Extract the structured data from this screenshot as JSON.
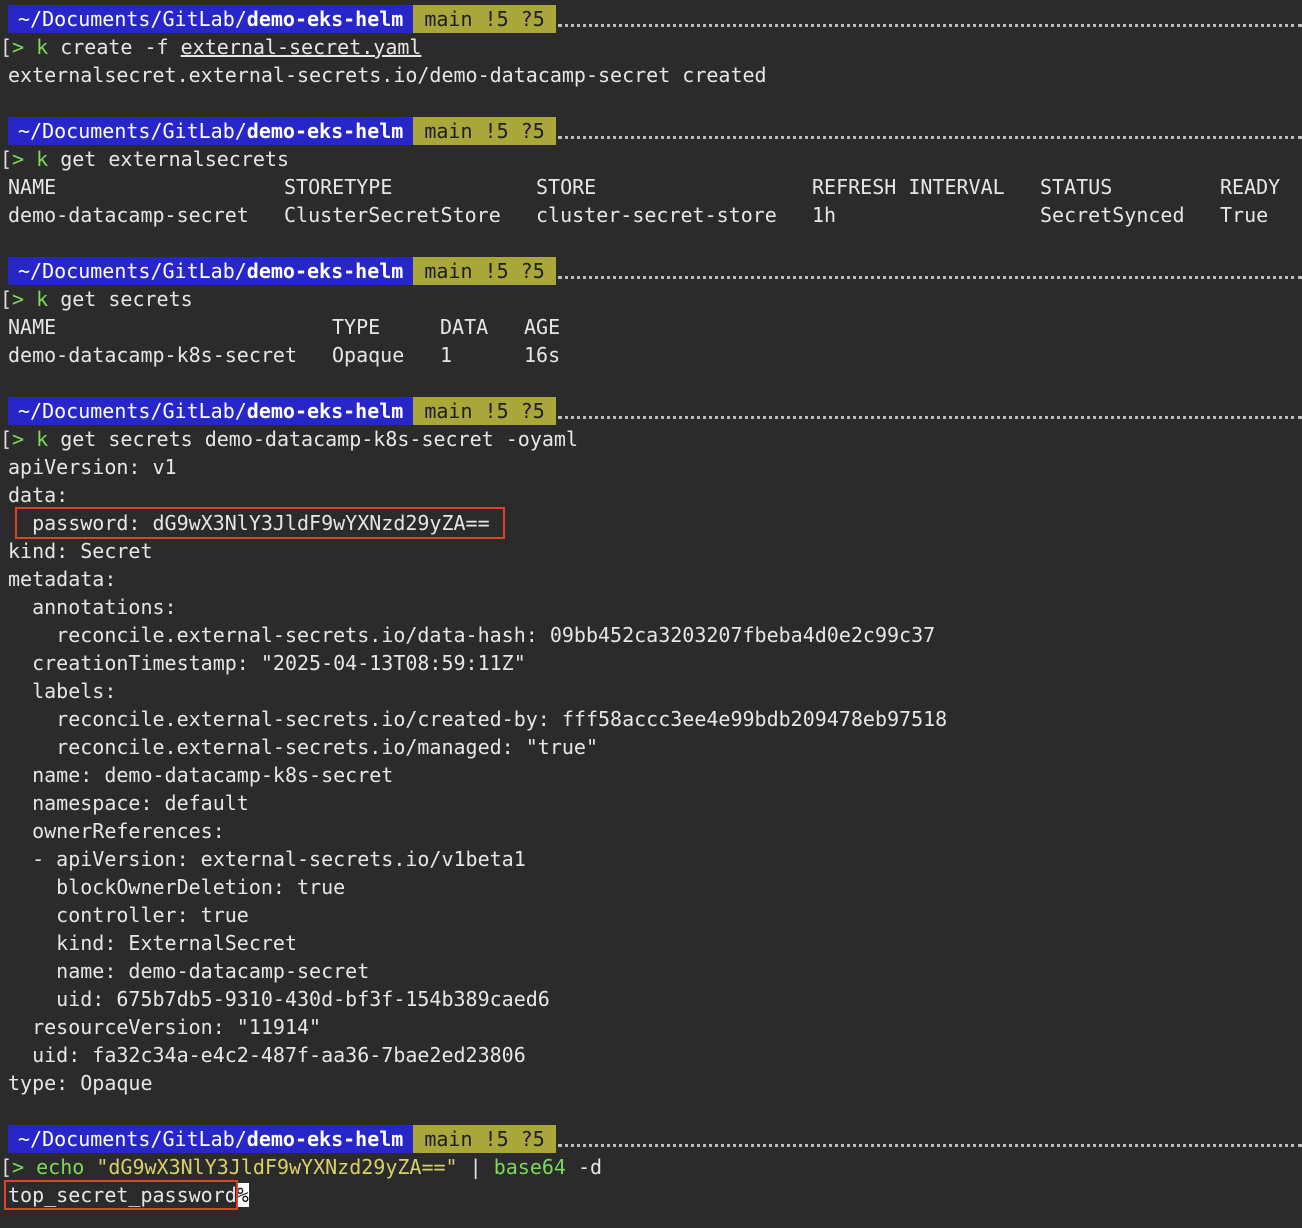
{
  "prompt": {
    "path_prefix": "~/Documents/GitLab/",
    "path_repo": "demo-eks-helm",
    "git": "main !5 ?5",
    "bracket": "[",
    "arrow": ">"
  },
  "block1": {
    "cmd_k": "k",
    "cmd_rest": " create -f ",
    "cmd_file": "external-secret.yaml",
    "output": "externalsecret.external-secrets.io/demo-datacamp-secret created"
  },
  "block2": {
    "cmd_k": "k",
    "cmd_rest": " get externalsecrets",
    "headers": [
      "NAME",
      "STORETYPE",
      "STORE",
      "REFRESH INTERVAL",
      "STATUS",
      "READY"
    ],
    "row": [
      "demo-datacamp-secret",
      "ClusterSecretStore",
      "cluster-secret-store",
      "1h",
      "SecretSynced",
      "True"
    ]
  },
  "block3": {
    "cmd_k": "k",
    "cmd_rest": " get secrets",
    "headers": [
      "NAME",
      "TYPE",
      "DATA",
      "AGE"
    ],
    "row": [
      "demo-datacamp-k8s-secret",
      "Opaque",
      "1",
      "16s"
    ]
  },
  "block4": {
    "cmd_k": "k",
    "cmd_rest": " get secrets demo-datacamp-k8s-secret -oyaml",
    "yaml": [
      "apiVersion: v1",
      "data:",
      "  password: dG9wX3NlY3JldF9wYXNzd29yZA==",
      "kind: Secret",
      "metadata:",
      "  annotations:",
      "    reconcile.external-secrets.io/data-hash: 09bb452ca3203207fbeba4d0e2c99c37",
      "  creationTimestamp: \"2025-04-13T08:59:11Z\"",
      "  labels:",
      "    reconcile.external-secrets.io/created-by: fff58accc3ee4e99bdb209478eb97518",
      "    reconcile.external-secrets.io/managed: \"true\"",
      "  name: demo-datacamp-k8s-secret",
      "  namespace: default",
      "  ownerReferences:",
      "  - apiVersion: external-secrets.io/v1beta1",
      "    blockOwnerDeletion: true",
      "    controller: true",
      "    kind: ExternalSecret",
      "    name: demo-datacamp-secret",
      "    uid: 675b7db5-9310-430d-bf3f-154b389caed6",
      "  resourceVersion: \"11914\"",
      "  uid: fa32c34a-e4c2-487f-aa36-7bae2ed23806",
      "type: Opaque"
    ]
  },
  "block5": {
    "cmd_echo": "echo",
    "cmd_str": " \"dG9wX3NlY3JldF9wYXNzd29yZA==\" ",
    "cmd_pipe": "|",
    "cmd_b64": " base64",
    "cmd_flag": " -d",
    "output": "top_secret_password",
    "cursor": "%"
  },
  "colors": {
    "background": "#2b2b2b",
    "path_segment": "#2727c9",
    "git_segment": "#a9a63a",
    "highlight_box": "#e0412b",
    "command_green": "#7ed957",
    "string_yellow": "#d8d266"
  }
}
